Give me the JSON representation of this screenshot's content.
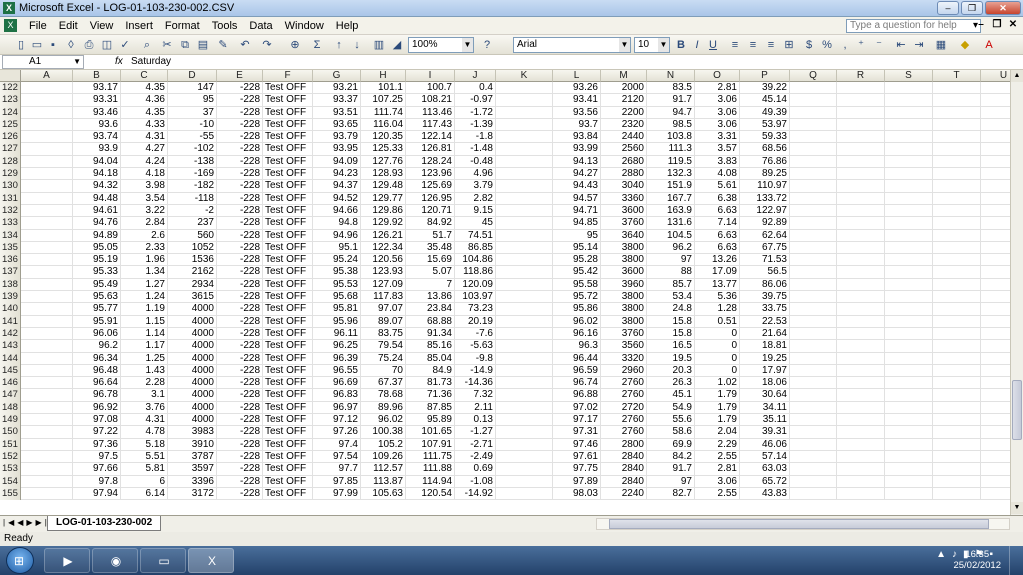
{
  "window": {
    "title": "Microsoft Excel - LOG-01-103-230-002.CSV"
  },
  "menu": [
    "File",
    "Edit",
    "View",
    "Insert",
    "Format",
    "Tools",
    "Data",
    "Window",
    "Help"
  ],
  "help": {
    "placeholder": "Type a question for help"
  },
  "toolbar": {
    "zoom": "100%",
    "font": "Arial",
    "size": "10"
  },
  "formula": {
    "cell": "A1",
    "fx": "fx",
    "content": "Saturday"
  },
  "columns": [
    "A",
    "B",
    "C",
    "D",
    "E",
    "F",
    "G",
    "H",
    "I",
    "J",
    "K",
    "L",
    "M",
    "N",
    "O",
    "P",
    "Q",
    "R",
    "S",
    "T",
    "U"
  ],
  "rows": [
    {
      "n": "122",
      "v": [
        "",
        "93.17",
        "4.35",
        "147",
        "-228",
        "Test OFF",
        "93.21",
        "101.1",
        "100.7",
        "0.4",
        "",
        "93.26",
        "2000",
        "83.5",
        "2.81",
        "39.22"
      ]
    },
    {
      "n": "123",
      "v": [
        "",
        "93.31",
        "4.36",
        "95",
        "-228",
        "Test OFF",
        "93.37",
        "107.25",
        "108.21",
        "-0.97",
        "",
        "93.41",
        "2120",
        "91.7",
        "3.06",
        "45.14"
      ]
    },
    {
      "n": "124",
      "v": [
        "",
        "93.46",
        "4.35",
        "37",
        "-228",
        "Test OFF",
        "93.51",
        "111.74",
        "113.46",
        "-1.72",
        "",
        "93.56",
        "2200",
        "94.7",
        "3.06",
        "49.39"
      ]
    },
    {
      "n": "125",
      "v": [
        "",
        "93.6",
        "4.33",
        "-10",
        "-228",
        "Test OFF",
        "93.65",
        "116.04",
        "117.43",
        "-1.39",
        "",
        "93.7",
        "2320",
        "98.5",
        "3.06",
        "53.97"
      ]
    },
    {
      "n": "126",
      "v": [
        "",
        "93.74",
        "4.31",
        "-55",
        "-228",
        "Test OFF",
        "93.79",
        "120.35",
        "122.14",
        "-1.8",
        "",
        "93.84",
        "2440",
        "103.8",
        "3.31",
        "59.33"
      ]
    },
    {
      "n": "127",
      "v": [
        "",
        "93.9",
        "4.27",
        "-102",
        "-228",
        "Test OFF",
        "93.95",
        "125.33",
        "126.81",
        "-1.48",
        "",
        "93.99",
        "2560",
        "111.3",
        "3.57",
        "68.56"
      ]
    },
    {
      "n": "128",
      "v": [
        "",
        "94.04",
        "4.24",
        "-138",
        "-228",
        "Test OFF",
        "94.09",
        "127.76",
        "128.24",
        "-0.48",
        "",
        "94.13",
        "2680",
        "119.5",
        "3.83",
        "76.86"
      ]
    },
    {
      "n": "129",
      "v": [
        "",
        "94.18",
        "4.18",
        "-169",
        "-228",
        "Test OFF",
        "94.23",
        "128.93",
        "123.96",
        "4.96",
        "",
        "94.27",
        "2880",
        "132.3",
        "4.08",
        "89.25"
      ]
    },
    {
      "n": "130",
      "v": [
        "",
        "94.32",
        "3.98",
        "-182",
        "-228",
        "Test OFF",
        "94.37",
        "129.48",
        "125.69",
        "3.79",
        "",
        "94.43",
        "3040",
        "151.9",
        "5.61",
        "110.97"
      ]
    },
    {
      "n": "131",
      "v": [
        "",
        "94.48",
        "3.54",
        "-118",
        "-228",
        "Test OFF",
        "94.52",
        "129.77",
        "126.95",
        "2.82",
        "",
        "94.57",
        "3360",
        "167.7",
        "6.38",
        "133.72"
      ]
    },
    {
      "n": "132",
      "v": [
        "",
        "94.61",
        "3.22",
        "-2",
        "-228",
        "Test OFF",
        "94.66",
        "129.86",
        "120.71",
        "9.15",
        "",
        "94.71",
        "3600",
        "163.9",
        "6.63",
        "122.97"
      ]
    },
    {
      "n": "133",
      "v": [
        "",
        "94.76",
        "2.84",
        "237",
        "-228",
        "Test OFF",
        "94.8",
        "129.92",
        "84.92",
        "45",
        "",
        "94.85",
        "3760",
        "131.6",
        "7.14",
        "92.89"
      ]
    },
    {
      "n": "134",
      "v": [
        "",
        "94.89",
        "2.6",
        "560",
        "-228",
        "Test OFF",
        "94.96",
        "126.21",
        "51.7",
        "74.51",
        "",
        "95",
        "3640",
        "104.5",
        "6.63",
        "62.64"
      ]
    },
    {
      "n": "135",
      "v": [
        "",
        "95.05",
        "2.33",
        "1052",
        "-228",
        "Test OFF",
        "95.1",
        "122.34",
        "35.48",
        "86.85",
        "",
        "95.14",
        "3800",
        "96.2",
        "6.63",
        "67.75"
      ]
    },
    {
      "n": "136",
      "v": [
        "",
        "95.19",
        "1.96",
        "1536",
        "-228",
        "Test OFF",
        "95.24",
        "120.56",
        "15.69",
        "104.86",
        "",
        "95.28",
        "3800",
        "97",
        "13.26",
        "71.53"
      ]
    },
    {
      "n": "137",
      "v": [
        "",
        "95.33",
        "1.34",
        "2162",
        "-228",
        "Test OFF",
        "95.38",
        "123.93",
        "5.07",
        "118.86",
        "",
        "95.42",
        "3600",
        "88",
        "17.09",
        "56.5"
      ]
    },
    {
      "n": "138",
      "v": [
        "",
        "95.49",
        "1.27",
        "2934",
        "-228",
        "Test OFF",
        "95.53",
        "127.09",
        "7",
        "120.09",
        "",
        "95.58",
        "3960",
        "85.7",
        "13.77",
        "86.06"
      ]
    },
    {
      "n": "139",
      "v": [
        "",
        "95.63",
        "1.24",
        "3615",
        "-228",
        "Test OFF",
        "95.68",
        "117.83",
        "13.86",
        "103.97",
        "",
        "95.72",
        "3800",
        "53.4",
        "5.36",
        "39.75"
      ]
    },
    {
      "n": "140",
      "v": [
        "",
        "95.77",
        "1.19",
        "4000",
        "-228",
        "Test OFF",
        "95.81",
        "97.07",
        "23.84",
        "73.23",
        "",
        "95.86",
        "3800",
        "24.8",
        "1.28",
        "33.75"
      ]
    },
    {
      "n": "141",
      "v": [
        "",
        "95.91",
        "1.15",
        "4000",
        "-228",
        "Test OFF",
        "95.96",
        "89.07",
        "68.88",
        "20.19",
        "",
        "96.02",
        "3800",
        "15.8",
        "0.51",
        "22.53"
      ]
    },
    {
      "n": "142",
      "v": [
        "",
        "96.06",
        "1.14",
        "4000",
        "-228",
        "Test OFF",
        "96.11",
        "83.75",
        "91.34",
        "-7.6",
        "",
        "96.16",
        "3760",
        "15.8",
        "0",
        "21.64"
      ]
    },
    {
      "n": "143",
      "v": [
        "",
        "96.2",
        "1.17",
        "4000",
        "-228",
        "Test OFF",
        "96.25",
        "79.54",
        "85.16",
        "-5.63",
        "",
        "96.3",
        "3560",
        "16.5",
        "0",
        "18.81"
      ]
    },
    {
      "n": "144",
      "v": [
        "",
        "96.34",
        "1.25",
        "4000",
        "-228",
        "Test OFF",
        "96.39",
        "75.24",
        "85.04",
        "-9.8",
        "",
        "96.44",
        "3320",
        "19.5",
        "0",
        "19.25"
      ]
    },
    {
      "n": "145",
      "v": [
        "",
        "96.48",
        "1.43",
        "4000",
        "-228",
        "Test OFF",
        "96.55",
        "70",
        "84.9",
        "-14.9",
        "",
        "96.59",
        "2960",
        "20.3",
        "0",
        "17.97"
      ]
    },
    {
      "n": "146",
      "v": [
        "",
        "96.64",
        "2.28",
        "4000",
        "-228",
        "Test OFF",
        "96.69",
        "67.37",
        "81.73",
        "-14.36",
        "",
        "96.74",
        "2760",
        "26.3",
        "1.02",
        "18.06"
      ]
    },
    {
      "n": "147",
      "v": [
        "",
        "96.78",
        "3.1",
        "4000",
        "-228",
        "Test OFF",
        "96.83",
        "78.68",
        "71.36",
        "7.32",
        "",
        "96.88",
        "2760",
        "45.1",
        "1.79",
        "30.64"
      ]
    },
    {
      "n": "148",
      "v": [
        "",
        "96.92",
        "3.76",
        "4000",
        "-228",
        "Test OFF",
        "96.97",
        "89.96",
        "87.85",
        "2.11",
        "",
        "97.02",
        "2720",
        "54.9",
        "1.79",
        "34.11"
      ]
    },
    {
      "n": "149",
      "v": [
        "",
        "97.08",
        "4.31",
        "4000",
        "-228",
        "Test OFF",
        "97.12",
        "96.02",
        "95.89",
        "0.13",
        "",
        "97.17",
        "2760",
        "55.6",
        "1.79",
        "35.11"
      ]
    },
    {
      "n": "150",
      "v": [
        "",
        "97.22",
        "4.78",
        "3983",
        "-228",
        "Test OFF",
        "97.26",
        "100.38",
        "101.65",
        "-1.27",
        "",
        "97.31",
        "2760",
        "58.6",
        "2.04",
        "39.31"
      ]
    },
    {
      "n": "151",
      "v": [
        "",
        "97.36",
        "5.18",
        "3910",
        "-228",
        "Test OFF",
        "97.4",
        "105.2",
        "107.91",
        "-2.71",
        "",
        "97.46",
        "2800",
        "69.9",
        "2.29",
        "46.06"
      ]
    },
    {
      "n": "152",
      "v": [
        "",
        "97.5",
        "5.51",
        "3787",
        "-228",
        "Test OFF",
        "97.54",
        "109.26",
        "111.75",
        "-2.49",
        "",
        "97.61",
        "2840",
        "84.2",
        "2.55",
        "57.14"
      ]
    },
    {
      "n": "153",
      "v": [
        "",
        "97.66",
        "5.81",
        "3597",
        "-228",
        "Test OFF",
        "97.7",
        "112.57",
        "111.88",
        "0.69",
        "",
        "97.75",
        "2840",
        "91.7",
        "2.81",
        "63.03"
      ]
    },
    {
      "n": "154",
      "v": [
        "",
        "97.8",
        "6",
        "3396",
        "-228",
        "Test OFF",
        "97.85",
        "113.87",
        "114.94",
        "-1.08",
        "",
        "97.89",
        "2840",
        "97",
        "3.06",
        "65.72"
      ]
    },
    {
      "n": "155",
      "v": [
        "",
        "97.94",
        "6.14",
        "3172",
        "-228",
        "Test OFF",
        "97.99",
        "105.63",
        "120.54",
        "-14.92",
        "",
        "98.03",
        "2240",
        "82.7",
        "2.55",
        "43.83"
      ]
    }
  ],
  "sheet": {
    "tab": "LOG-01-103-230-002"
  },
  "status": {
    "text": "Ready"
  },
  "clock": {
    "time": "16:35",
    "date": "25/02/2012"
  }
}
